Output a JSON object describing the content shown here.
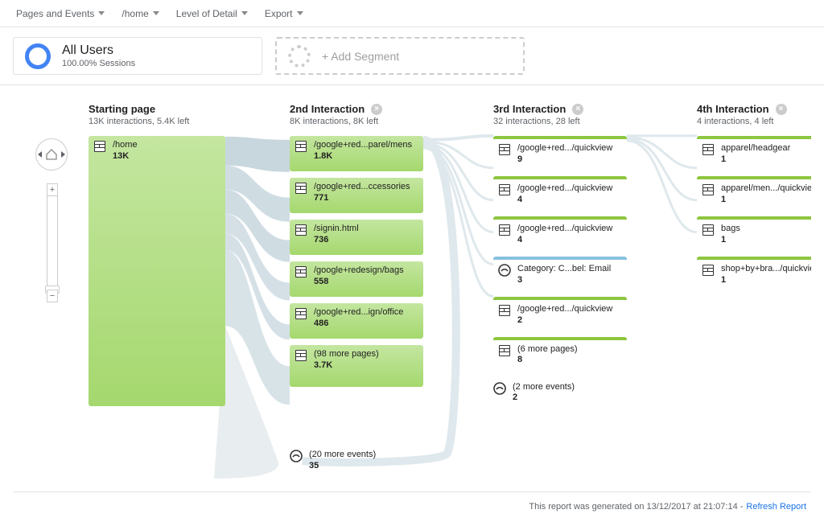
{
  "toolbar": {
    "pages_events": "Pages and Events",
    "home": "/home",
    "level": "Level of Detail",
    "export": "Export"
  },
  "segment": {
    "title": "All Users",
    "sub": "100.00% Sessions",
    "add": "+ Add Segment"
  },
  "columns": [
    {
      "title": "Starting page",
      "sub": "13K interactions, 5.4K left",
      "closable": false
    },
    {
      "title": "2nd Interaction",
      "sub": "8K interactions, 8K left",
      "closable": true
    },
    {
      "title": "3rd Interaction",
      "sub": "32 interactions, 28 left",
      "closable": true
    },
    {
      "title": "4th Interaction",
      "sub": "4 interactions, 4 left",
      "closable": true
    }
  ],
  "col1": {
    "label": "/home",
    "val": "13K"
  },
  "col2": [
    {
      "label": "/google+red...parel/mens",
      "val": "1.8K"
    },
    {
      "label": "/google+red...ccessories",
      "val": "771"
    },
    {
      "label": "/signin.html",
      "val": "736"
    },
    {
      "label": "/google+redesign/bags",
      "val": "558"
    },
    {
      "label": "/google+red...ign/office",
      "val": "486"
    },
    {
      "label": "(98 more pages)",
      "val": "3.7K"
    }
  ],
  "col2_more": {
    "label": "(20 more events)",
    "val": "35"
  },
  "col3": [
    {
      "label": "/google+red.../quickview",
      "val": "9",
      "type": "page"
    },
    {
      "label": "/google+red.../quickview",
      "val": "4",
      "type": "page"
    },
    {
      "label": "/google+red.../quickview",
      "val": "4",
      "type": "page"
    },
    {
      "label": "Category: C...bel: Email",
      "val": "3",
      "type": "event"
    },
    {
      "label": "/google+red.../quickview",
      "val": "2",
      "type": "page"
    },
    {
      "label": "(6 more pages)",
      "val": "8",
      "type": "page"
    },
    {
      "label": "(2 more events)",
      "val": "2",
      "type": "event"
    }
  ],
  "col4": [
    {
      "label": "apparel/headgear",
      "val": "1"
    },
    {
      "label": "apparel/men.../quickview",
      "val": "1"
    },
    {
      "label": "bags",
      "val": "1"
    },
    {
      "label": "shop+by+bra.../quickview",
      "val": "1"
    }
  ],
  "footer": {
    "text": "This report was generated on 13/12/2017 at 21:07:14 -",
    "link": "Refresh Report"
  }
}
